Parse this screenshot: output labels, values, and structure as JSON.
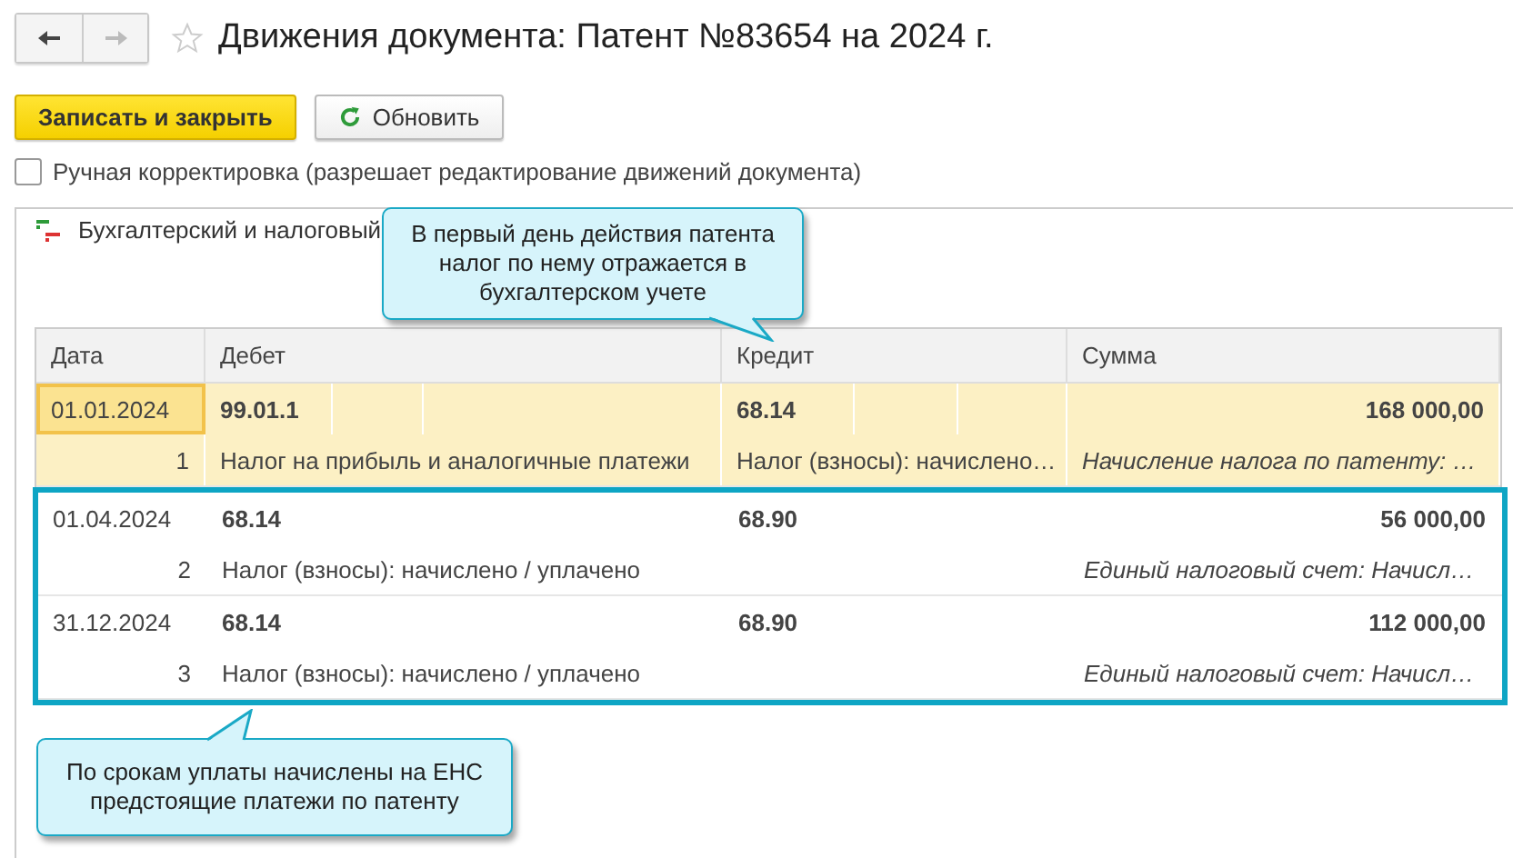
{
  "window": {
    "title": "Движения документа: Патент №83654 на 2024 г.",
    "favorite": false
  },
  "toolbar": {
    "buttons": [
      {
        "label": "Записать и закрыть",
        "kind": "primary"
      },
      {
        "label": "Обновить",
        "kind": "refresh"
      }
    ]
  },
  "manual_edit": {
    "label": "Ручная корректировка (разрешает редактирование движений документа)",
    "checked": false
  },
  "tab": {
    "label": "Бухгалтерский и налоговый"
  },
  "table": {
    "columns": [
      "Дата",
      "Дебет",
      "Кредит",
      "Сумма"
    ],
    "rows": [
      {
        "date": "01.01.2024",
        "debit": "99.01.1",
        "credit": "68.14",
        "sum": "168 000,00",
        "number": "1",
        "debit_desc": "Налог на прибыль и аналогичные платежи",
        "credit_desc": "Налог (взносы): начислено…",
        "sum_desc": "Начисление налога по патенту: …",
        "selected": true,
        "framed": false
      },
      {
        "date": "01.04.2024",
        "debit": "68.14",
        "credit": "68.90",
        "sum": "56 000,00",
        "number": "2",
        "debit_desc": "Налог (взносы): начислено / уплачено",
        "sum_desc": "Единый налоговый счет: Начисл…",
        "selected": false,
        "framed": true
      },
      {
        "date": "31.12.2024",
        "debit": "68.14",
        "credit": "68.90",
        "sum": "112 000,00",
        "number": "3",
        "debit_desc": "Налог (взносы): начислено / уплачено",
        "sum_desc": "Единый налоговый счет: Начисл…",
        "selected": false,
        "framed": true
      }
    ]
  },
  "callouts": [
    {
      "text": "В первый день действия патента налог по нему отражается в бухгалтерском учете"
    },
    {
      "text": "По срокам уплаты начислены на ЕНС предстоящие платежи по патенту"
    }
  ]
}
